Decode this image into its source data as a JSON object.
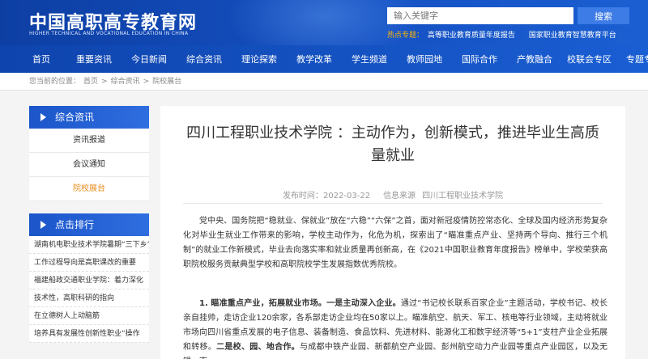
{
  "header": {
    "logo_cn": "中国高职高专教育网",
    "logo_en": "HIGHER TECHNICAL AND VOCATIONAL EDUCATION IN CHINA",
    "search_placeholder": "输入关键字",
    "search_button": "搜索",
    "hot_label": "热点专题：",
    "hot_topics": [
      "高等职业教育质量年度报告",
      "国家职业教育智慧教育平台"
    ]
  },
  "nav": [
    "首页",
    "重要资讯",
    "今日新闻",
    "综合资讯",
    "理论探索",
    "教学改革",
    "学生频道",
    "教师园地",
    "国际合作",
    "产教融合",
    "校联会专区",
    "专题专栏"
  ],
  "breadcrumb": {
    "prefix": "您当前的位置：",
    "items": [
      "首页",
      "综合资讯",
      "院校展台"
    ],
    "sep": ">"
  },
  "sidebar": {
    "section1_title": "综合资讯",
    "items": [
      "资讯报道",
      "会议通知",
      "院校展台"
    ],
    "section2_title": "点击排行",
    "rank": [
      "湖南机电职业技术学院暑期“三下乡”",
      "工作过程导向是高职课改的重要",
      "福建船政交通职业学院：着力深化",
      "技术性，高职科研的指向",
      "在立德树人上动脑筋",
      "培养具有发展性创新性职业“操作"
    ]
  },
  "article": {
    "title": "四川工程职业技术学院 ：主动作为，创新模式，推进毕业生高质量就业",
    "publish_label": "发布时间：",
    "publish_date": "2022-03-22",
    "source_label": "信息来源",
    "source": "四川工程职业技术学院",
    "p1": "党中央、国务院把“稳就业、保就业”放在“六稳”“六保”之首，面对新冠疫情防控常态化、全球及国内经济形势复杂化对毕业生就业工作带来的影响，学校主动作为，化危为机，探索出了“瞄准重点产业、坚持两个导向、推行三个机制”的就业工作新模式，毕业去向落实率和就业质量再创新高，在《2021中国职业教育年度报告》榜单中，学校荣获高职院校服务贡献典型学校和高职院校学生发展指数优秀院校。",
    "p2_bold": "1. 瞄准重点产业，拓展就业市场。一是主动深入企业。",
    "p2_text": "通过“书记校长联系百家企业”主题活动，学校书记、校长亲自挂帅，走访企业120余家，各系部走访企业均在50家以上。瞄准航空、航天、军工、核电等行业领域，主动将就业市场向四川省重点发展的电子信息、装备制造、食品饮料、先进材料、能源化工和数字经济等“5+1”支柱产业企业拓展和转移。",
    "p2_bold2": "二是校、园、地合作。",
    "p2_text2": "与成都中铁产业园、新都航空产业园、彭州航空动力产业园等重点产业园区，以及无锡、南"
  }
}
